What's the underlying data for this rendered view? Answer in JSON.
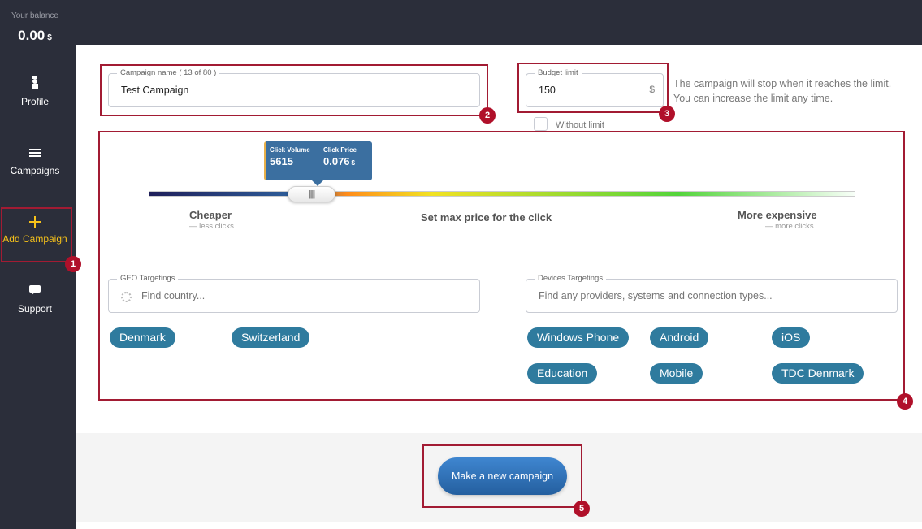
{
  "sidebar": {
    "balance_label": "Your balance",
    "balance_value": "0.00",
    "balance_currency": "$",
    "items": [
      {
        "label": "Profile",
        "icon": "profile-icon"
      },
      {
        "label": "Campaigns",
        "icon": "menu-icon"
      },
      {
        "label": "Add Campaign",
        "icon": "plus-icon"
      },
      {
        "label": "Support",
        "icon": "chat-icon"
      }
    ]
  },
  "campaign_name": {
    "legend": "Campaign name ( 13 of 80 )",
    "value": "Test Campaign"
  },
  "budget": {
    "legend": "Budget limit",
    "value": "150",
    "currency": "$",
    "hint": "The campaign will stop when it reaches the limit. You can increase the limit any time.",
    "without_limit_label": "Without limit"
  },
  "slider": {
    "click_volume_label": "Click Volume",
    "click_volume_value": "5615",
    "click_price_label": "Click Price",
    "click_price_value": "0.076",
    "click_price_currency": "$",
    "thumb_glyph": "||||",
    "cheaper_label": "Cheaper",
    "cheaper_sub": "— less clicks",
    "center_label": "Set max price for the click",
    "expensive_label": "More expensive",
    "expensive_sub": "— more clicks"
  },
  "geo": {
    "legend": "GEO Targetings",
    "placeholder": "Find country...",
    "chips": [
      "Denmark",
      "Switzerland"
    ]
  },
  "devices": {
    "legend": "Devices Targetings",
    "placeholder": "Find any providers, systems and connection types...",
    "chips": [
      "Windows Phone",
      "Android",
      "iOS",
      "Education",
      "Mobile",
      "TDC Denmark"
    ]
  },
  "cta_label": "Make a new campaign",
  "badges": [
    "1",
    "2",
    "3",
    "4",
    "5"
  ],
  "colors": {
    "sidebar_bg": "#2b2e3a",
    "accent_yellow": "#f7c21a",
    "chip_bg": "#2f7b9e",
    "highlight_red": "#a21b33",
    "cta_blue": "#2f72b8"
  }
}
